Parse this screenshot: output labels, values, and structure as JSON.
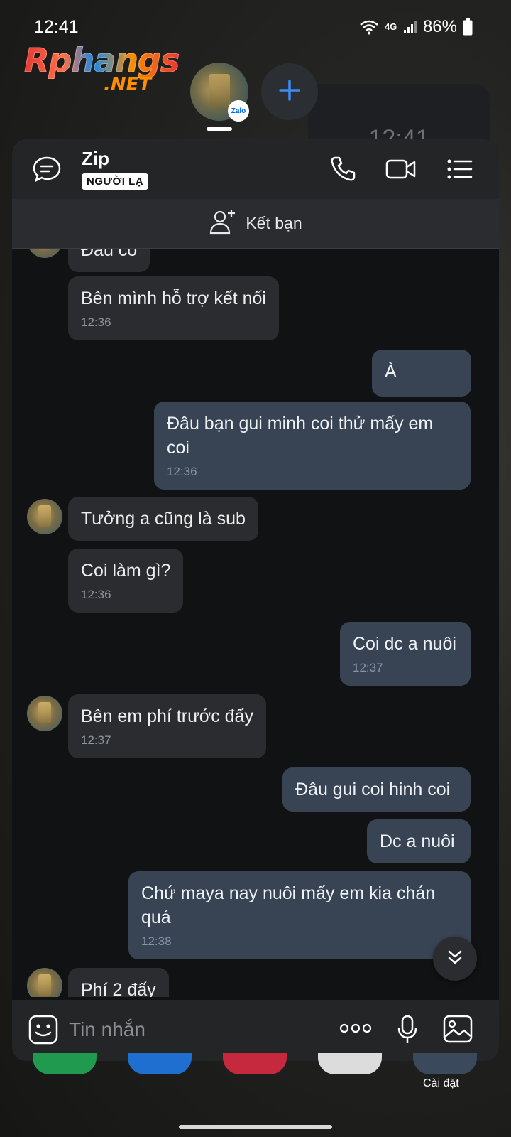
{
  "status_bar": {
    "time": "12:41",
    "network": "4G",
    "battery": "86%"
  },
  "watermark": {
    "name": "Rphangs",
    "domain": ".NET"
  },
  "bubble": {
    "badge": "Zalo"
  },
  "background_card": {
    "clock": "12:41"
  },
  "header": {
    "name": "Zip",
    "badge": "NGƯỜI LẠ"
  },
  "add_friend": {
    "label": "Kết bạn"
  },
  "messages": [
    {
      "dir": "in",
      "text": "Đâu có",
      "time": ""
    },
    {
      "dir": "in",
      "text": "Bên mình hỗ trợ kết nối",
      "time": "12:36"
    },
    {
      "dir": "out",
      "text": "À",
      "time": ""
    },
    {
      "dir": "out",
      "text": "Đâu bạn gui minh coi thử mấy em coi",
      "time": "12:36"
    },
    {
      "dir": "in",
      "text": "Tưởng a cũng là sub",
      "time": ""
    },
    {
      "dir": "in",
      "text": "Coi làm gì?",
      "time": "12:36"
    },
    {
      "dir": "out",
      "text": "Coi dc a nuôi",
      "time": "12:37"
    },
    {
      "dir": "in",
      "text": "Bên em phí trước đấy",
      "time": "12:37"
    },
    {
      "dir": "out",
      "text": "Đâu gui coi hinh coi",
      "time": ""
    },
    {
      "dir": "out",
      "text": "Dc a nuôi",
      "time": ""
    },
    {
      "dir": "out",
      "text": "Chứ maya nay nuôi mấy em kia chán quá",
      "time": "12:38"
    },
    {
      "dir": "in",
      "text": "Phí 2 đấy",
      "time": ""
    }
  ],
  "input": {
    "placeholder": "Tin nhắn"
  },
  "dock": {
    "settings_label": "Cài đặt"
  },
  "colors": {
    "incoming": "#2b2c2f",
    "outgoing": "#384454",
    "accent": "#1e88e5",
    "background": "#111213"
  }
}
